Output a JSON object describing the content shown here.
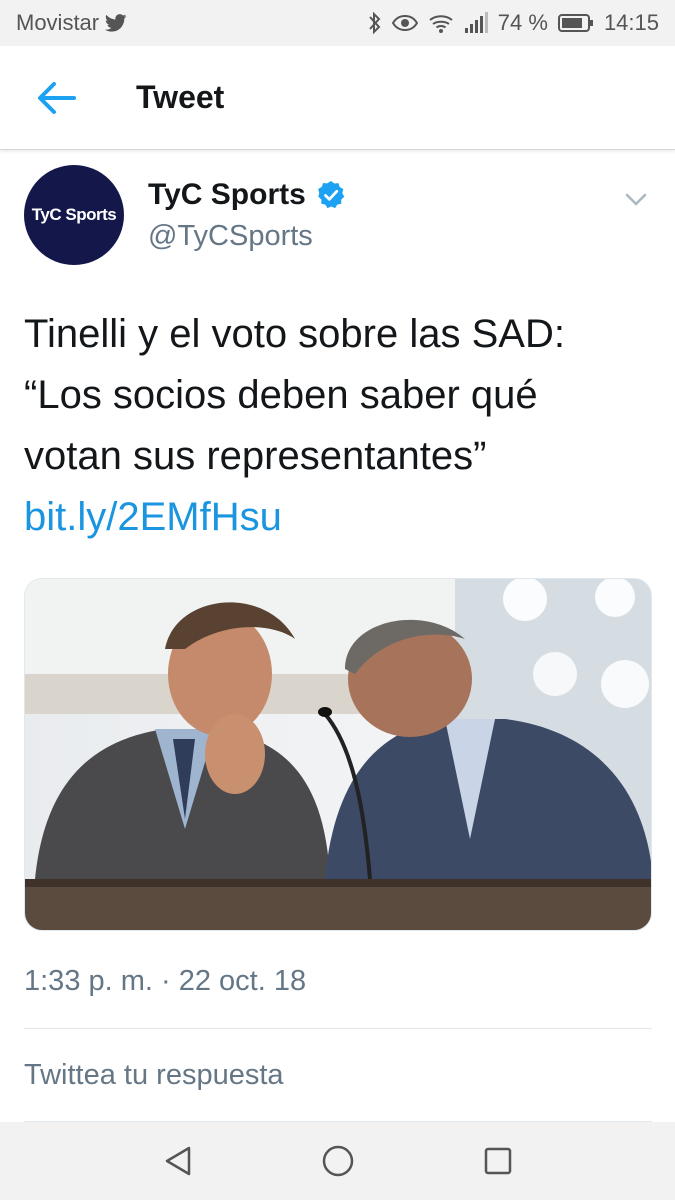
{
  "status_bar": {
    "carrier": "Movistar",
    "battery_percent": "74 %",
    "time": "14:15",
    "icons": [
      "twitter-icon",
      "bluetooth-icon",
      "eye-icon",
      "wifi-icon",
      "signal-icon",
      "battery-icon"
    ]
  },
  "header": {
    "back_icon": "back-arrow-icon",
    "title": "Tweet"
  },
  "tweet": {
    "avatar_text": "TyC Sports",
    "author_name": "TyC Sports",
    "verified": true,
    "handle": "@TyCSports",
    "text_lines": [
      "Tinelli y el voto sobre las SAD:",
      "“Los socios deben saber qué",
      "votan sus representantes”"
    ],
    "link": "bit.ly/2EMfHsu",
    "timestamp": "1:33 p. m. · 22 oct. 18"
  },
  "reply": {
    "placeholder": "Twittea tu respuesta"
  },
  "nav_bar": {
    "buttons": [
      "back-triangle-icon",
      "home-circle-icon",
      "recents-square-icon"
    ]
  },
  "colors": {
    "accent": "#1da1f2",
    "link": "#1b95e0",
    "text": "#14171a",
    "muted": "#657786",
    "avatar_bg": "#14174a"
  }
}
